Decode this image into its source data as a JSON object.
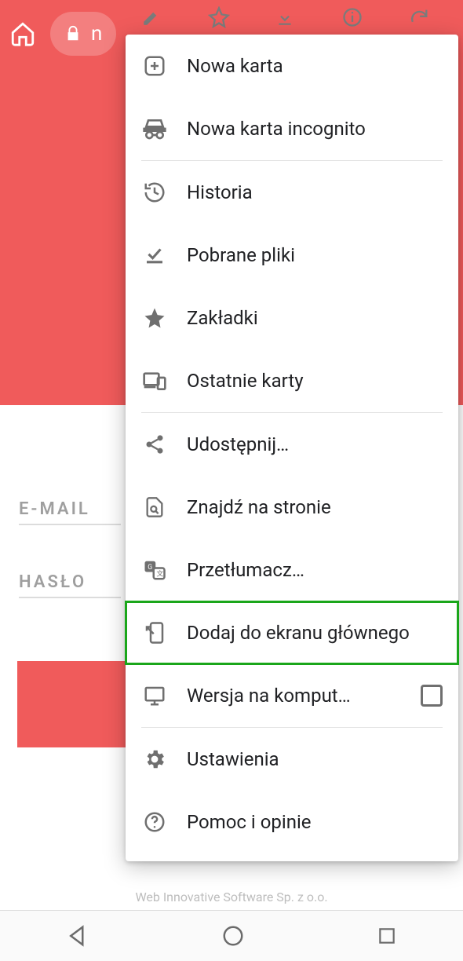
{
  "toolbar": {
    "url_fragment": "n"
  },
  "page": {
    "email_label": "E-MAIL",
    "password_label": "HASŁO",
    "footer_text": "Web Innovative Software Sp. z o.o."
  },
  "quick_actions": {
    "edit": "edit-icon",
    "bookmark": "star-outline-icon",
    "download": "download-icon",
    "info": "info-icon",
    "refresh": "refresh-icon"
  },
  "menu": {
    "items": [
      {
        "id": "new-tab",
        "label": "Nowa karta"
      },
      {
        "id": "incognito",
        "label": "Nowa karta incognito"
      },
      {
        "id": "history",
        "label": "Historia"
      },
      {
        "id": "downloads",
        "label": "Pobrane pliki"
      },
      {
        "id": "bookmarks",
        "label": "Zakładki"
      },
      {
        "id": "recent-tabs",
        "label": "Ostatnie karty"
      },
      {
        "id": "share",
        "label": "Udostępnij…"
      },
      {
        "id": "find",
        "label": "Znajdź na stronie"
      },
      {
        "id": "translate",
        "label": "Przetłumacz…"
      },
      {
        "id": "add-home",
        "label": "Dodaj do ekranu głównego"
      },
      {
        "id": "desktop",
        "label": "Wersja na komput…",
        "checkbox": false
      },
      {
        "id": "settings",
        "label": "Ustawienia"
      },
      {
        "id": "help",
        "label": "Pomoc i opinie"
      }
    ]
  }
}
